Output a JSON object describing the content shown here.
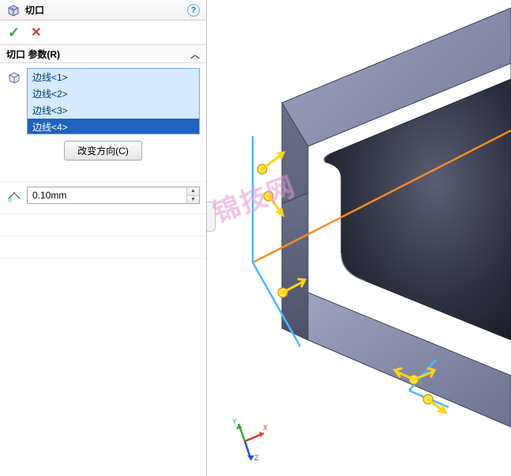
{
  "feature": {
    "title": "切口",
    "help_icon": "?"
  },
  "actions": {
    "ok": "✓",
    "cancel": "✕"
  },
  "section": {
    "title": "切口 参数(R)"
  },
  "edges": {
    "items": [
      {
        "label": "边线<1>",
        "selected": false
      },
      {
        "label": "边线<2>",
        "selected": false
      },
      {
        "label": "边线<3>",
        "selected": false
      },
      {
        "label": "边线<4>",
        "selected": true
      }
    ]
  },
  "buttons": {
    "reverse_direction": "改变方向(C)"
  },
  "dimension": {
    "gap_value": "0.10mm"
  },
  "icons": {
    "feature": "cube-cut-icon",
    "edge_selector": "cube-icon",
    "gap": "gap-dimension-icon"
  },
  "watermark": "锦技网",
  "colors": {
    "model_body": "#5c6278",
    "model_top": "#7b80a0",
    "model_inner": "#313441",
    "edge_orange": "#ff8a1f",
    "edge_blue": "#4fb4ff",
    "arrow_yellow": "#ffd21a",
    "axis_x": "#d43a2a",
    "axis_y": "#3aa23a",
    "axis_z": "#2a4ed4"
  }
}
